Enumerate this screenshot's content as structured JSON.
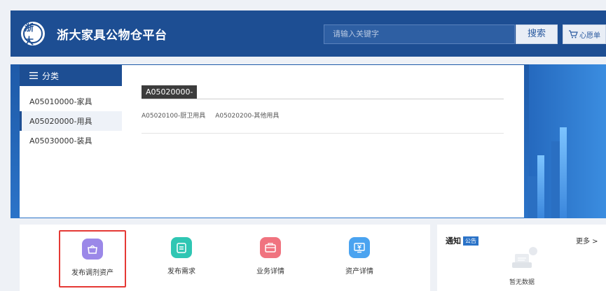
{
  "header": {
    "logo_text": "浙大",
    "site_title": "浙大家具公物仓平台",
    "search_placeholder": "请输入关键字",
    "search_button": "搜索",
    "wishlist_label": "心愿单"
  },
  "sidebar": {
    "heading": "分类",
    "items": [
      {
        "label": "A05010000-家具",
        "active": false
      },
      {
        "label": "A05020000-用具",
        "active": true
      },
      {
        "label": "A05030000-装具",
        "active": false
      }
    ]
  },
  "category_panel": {
    "tag": "A05020000-",
    "subcategories": [
      "A05020100-厨卫用具",
      "A05020200-其他用具"
    ]
  },
  "actions": [
    {
      "label": "发布调剂资产",
      "icon": "pot-icon",
      "color": "#9b88e8",
      "selected": true
    },
    {
      "label": "发布需求",
      "icon": "clipboard-icon",
      "color": "#2fc6b3",
      "selected": false
    },
    {
      "label": "业务详情",
      "icon": "briefcase-icon",
      "color": "#f0737f",
      "selected": false
    },
    {
      "label": "资产详情",
      "icon": "yuan-monitor-icon",
      "color": "#4aa3f0",
      "selected": false
    }
  ],
  "notice": {
    "title": "通知",
    "badge": "公告",
    "more": "更多 >",
    "empty_text": "暂无数据"
  },
  "colors": {
    "brand": "#1d4e93",
    "banner": "#2b73c8",
    "highlight_border": "#e53935"
  }
}
